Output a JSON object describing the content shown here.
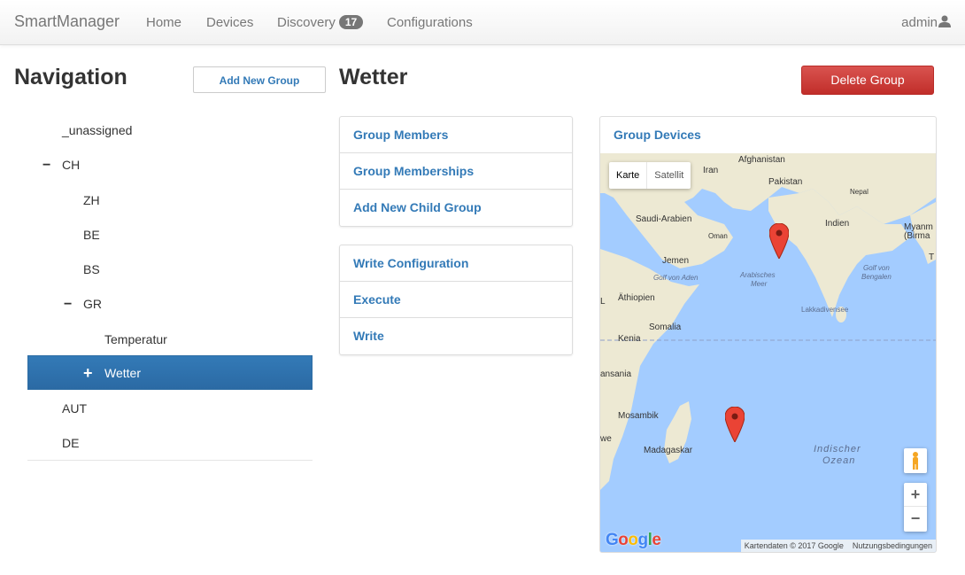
{
  "navbar": {
    "brand": "SmartManager",
    "links": [
      {
        "label": "Home"
      },
      {
        "label": "Devices"
      },
      {
        "label": "Discovery",
        "badge": "17"
      },
      {
        "label": "Configurations"
      }
    ],
    "user": "admin"
  },
  "sidebar": {
    "title": "Navigation",
    "add_group_label": "Add New Group",
    "tree": [
      {
        "label": "_unassigned",
        "toggle": ""
      },
      {
        "label": "CH",
        "toggle": "−"
      },
      {
        "label": "ZH",
        "toggle": ""
      },
      {
        "label": "BE",
        "toggle": ""
      },
      {
        "label": "BS",
        "toggle": ""
      },
      {
        "label": "GR",
        "toggle": "−"
      },
      {
        "label": "Temperatur",
        "toggle": ""
      },
      {
        "label": "Wetter",
        "toggle": "+",
        "active": true
      },
      {
        "label": "AUT",
        "toggle": ""
      },
      {
        "label": "DE",
        "toggle": ""
      }
    ]
  },
  "main": {
    "title": "Wetter",
    "delete_label": "Delete Group",
    "menu1": [
      "Group Members",
      "Group Memberships",
      "Add New Child Group"
    ],
    "menu2": [
      "Write Configuration",
      "Execute",
      "Write"
    ]
  },
  "map_panel": {
    "title": "Group Devices",
    "map_type_map": "Karte",
    "map_type_satellite": "Satellit",
    "zoom_in": "+",
    "zoom_out": "−",
    "logo": "Google",
    "attribution": "Kartendaten © 2017 Google",
    "terms": "Nutzungsbedingungen",
    "labels": {
      "afghanistan": "Afghanistan",
      "iran": "Iran",
      "pakistan": "Pakistan",
      "nepal": "Nepal",
      "saudi": "Saudi-Arabien",
      "oman": "Oman",
      "indien": "Indien",
      "myanmar": "Myanm",
      "birma": "(Birma",
      "jemen": "Jemen",
      "golf_aden": "Golf von Aden",
      "arab_sea_1": "Arabisches",
      "arab_sea_2": "Meer",
      "golf_bengalen_1": "Golf von",
      "golf_bengalen_2": "Bengalen",
      "aethiopien": "Äthiopien",
      "lakkadiv": "Lakkadivensee",
      "somalia": "Somalia",
      "kenia": "Kenia",
      "tansania": "ansania",
      "mosambik": "Mosambik",
      "we": "we",
      "madagaskar": "Madagaskar",
      "indischer_1": "Indischer",
      "indischer_2": "Ozean",
      "edge_l": "L",
      "edge_t": "T"
    },
    "colors": {
      "land": "#ede9d3",
      "water": "#a3ccff",
      "marker": "#ea4335"
    }
  }
}
